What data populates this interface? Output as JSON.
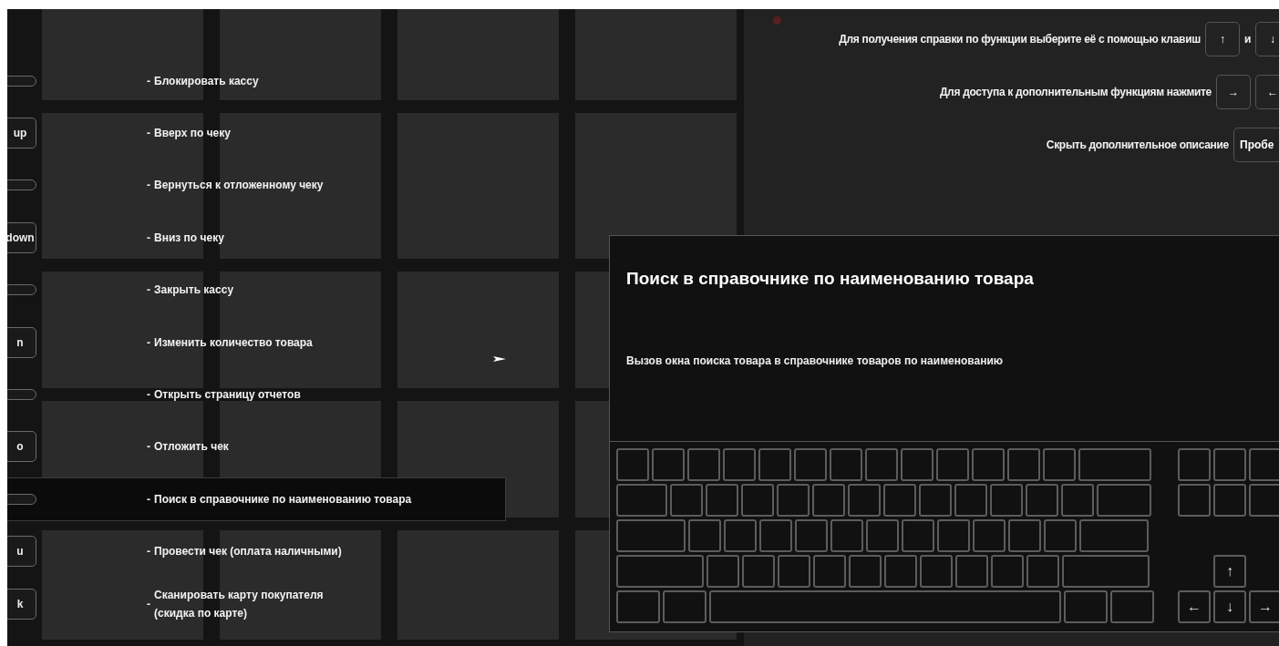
{
  "hotkeys": [
    {
      "dash": "-",
      "label": "Блокировать кассу",
      "selected": false
    },
    {
      "key": "up",
      "dash": "-",
      "label": "Вверх по чеку",
      "selected": false
    },
    {
      "dash": "-",
      "label": "Вернуться к отложенному чеку",
      "selected": false
    },
    {
      "key": "down",
      "dash": "-",
      "label": "Вниз по чеку",
      "selected": false
    },
    {
      "dash": "-",
      "label": "Закрыть кассу",
      "selected": false
    },
    {
      "key": "n",
      "dash": "-",
      "label": "Изменить количество товара",
      "selected": false
    },
    {
      "dash": "-",
      "label": "Открыть страницу отчетов",
      "selected": false
    },
    {
      "key": "o",
      "dash": "-",
      "label": "Отложить чек",
      "selected": false
    },
    {
      "dash": "-",
      "label": "Поиск в справочнике по наименованию товара",
      "selected": true
    },
    {
      "key": "u",
      "dash": "-",
      "label": "Провести чек (оплата наличными)",
      "selected": false
    },
    {
      "key": "k",
      "dash": "-",
      "label": "Сканировать карту покупателя (скидка по карте)",
      "selected": false
    }
  ],
  "help": [
    {
      "parts": [
        {
          "kind": "text",
          "text": "Для получения справки по функции выберите её с помощью клавиш"
        },
        {
          "kind": "key",
          "text": "↑"
        },
        {
          "kind": "text",
          "text": "и"
        },
        {
          "kind": "key",
          "text": "↓"
        }
      ]
    },
    {
      "parts": [
        {
          "kind": "text",
          "text": "Для доступа к дополнительным функциям нажмите"
        },
        {
          "kind": "key",
          "text": "→"
        },
        {
          "kind": "key",
          "text": "←"
        }
      ]
    },
    {
      "parts": [
        {
          "kind": "text",
          "text": "Скрыть дополнительное описание"
        },
        {
          "kind": "key",
          "text": "Пробе"
        }
      ]
    }
  ],
  "detail": {
    "title": "Поиск в справочнике по наименованию товара",
    "description": "Вызов окна поиска товара в справочнике товаров по наименованию"
  },
  "keyboard": {
    "arrows": [
      {
        "kind": "up",
        "text": "↑"
      },
      {
        "kind": "left",
        "text": "←"
      },
      {
        "kind": "down",
        "text": "↓"
      },
      {
        "kind": "right",
        "text": "→"
      }
    ]
  }
}
